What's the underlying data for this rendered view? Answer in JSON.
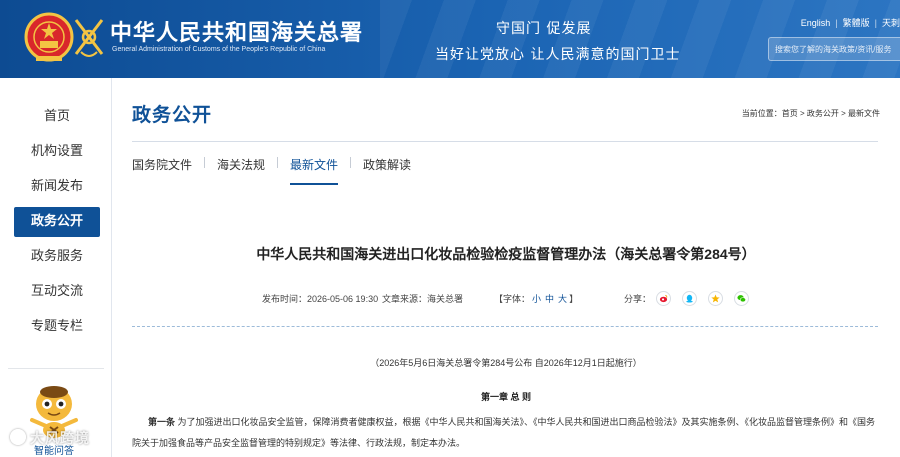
{
  "header": {
    "site_title": "中华人民共和国海关总署",
    "site_subtitle": "General Administration of Customs of the People's Republic of China",
    "slogan_line1": "守国门  促发展",
    "slogan_line2": "当好让党放心   让人民满意的国门卫士",
    "lang_english": "English",
    "lang_traditional": "繁體版",
    "lang_more": "天刺",
    "search_placeholder": "搜索您了解的海关政策/资讯/服务",
    "colors": {
      "header_blue": "#0d4b92",
      "accent": "#0f5197"
    }
  },
  "sidebar": {
    "items": [
      {
        "label": "首页",
        "active": false
      },
      {
        "label": "机构设置",
        "active": false
      },
      {
        "label": "新闻发布",
        "active": false
      },
      {
        "label": "政务公开",
        "active": true
      },
      {
        "label": "政务服务",
        "active": false
      },
      {
        "label": "互动交流",
        "active": false
      },
      {
        "label": "专题专栏",
        "active": false
      }
    ],
    "mascot_label": "智能问答"
  },
  "content": {
    "section_title": "政务公开",
    "breadcrumb": {
      "prefix": "当前位置：",
      "items": [
        "首页",
        "政务公开",
        "最新文件"
      ],
      "separator": " > "
    },
    "tabs": [
      {
        "label": "国务院文件",
        "active": false
      },
      {
        "label": "海关法规",
        "active": false
      },
      {
        "label": "最新文件",
        "active": true
      },
      {
        "label": "政策解读",
        "active": false
      }
    ],
    "article": {
      "title": "中华人民共和国海关进出口化妆品检验检疫监督管理办法（海关总署令第284号）",
      "publish_time_label": "发布时间：",
      "publish_time": "2026-05-06 19:30",
      "source_label": "文章来源：",
      "source": "海关总署",
      "font_label_open": "【字体：",
      "font_small": "小",
      "font_medium": "中",
      "font_large": "大",
      "font_label_close": "】",
      "share_label": "分享：",
      "share_icons": [
        "weibo-icon",
        "qq-icon",
        "qzone-icon",
        "wechat-icon"
      ],
      "promulgation": "（2026年5月6日海关总署令第284号公布 自2026年12月1日起施行）",
      "chapter": "第一章 总  则",
      "article_one_label": "第一条",
      "article_one_text": " 为了加强进出口化妆品安全监管，保障消费者健康权益，根据《中华人民共和国海关法》、《中华人民共和国进出口商品检验法》及其实施条例、《化妆品监督管理条例》和《国务院关于加强食品等产品安全监督管理的特别规定》等法律、行政法规，制定本办法。"
    }
  },
  "watermark": "大风跨境"
}
